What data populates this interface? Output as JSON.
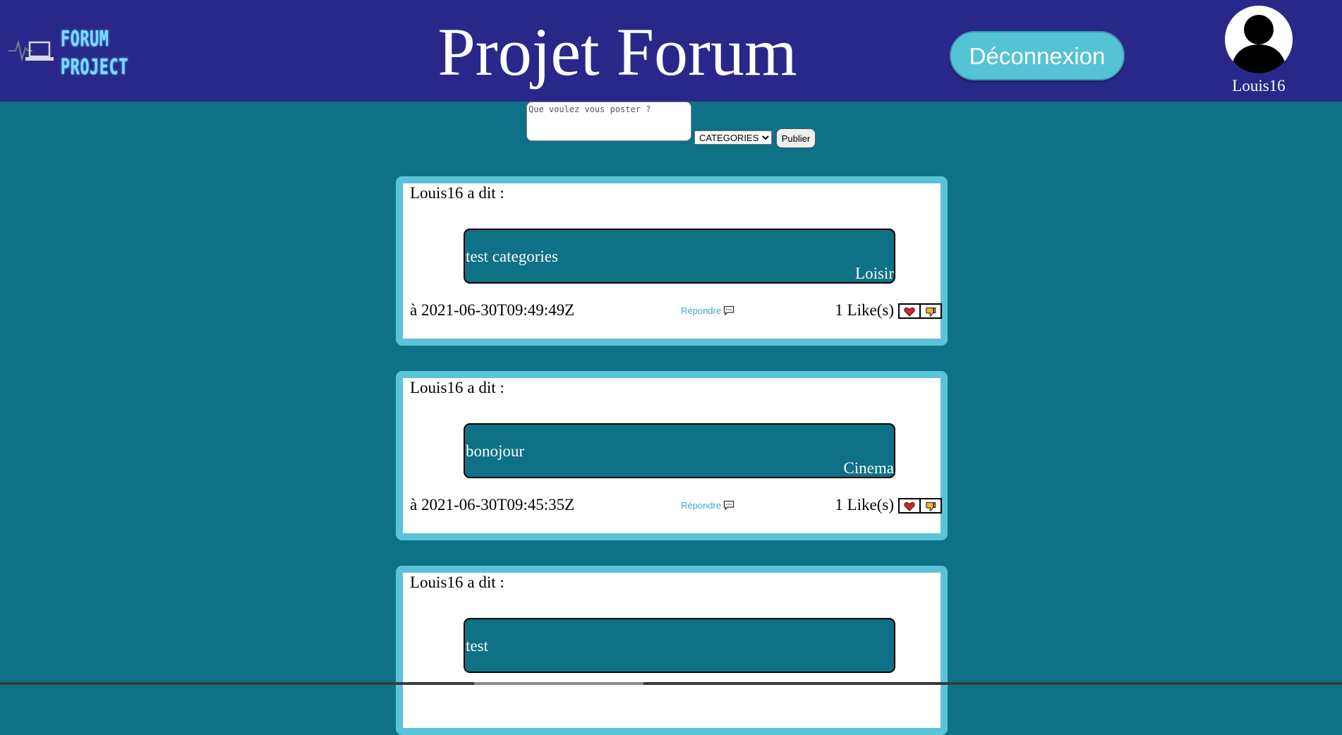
{
  "header": {
    "logo_text_line1": "FORUM",
    "logo_text_line2": "PROJECT",
    "title": "Projet Forum",
    "logout_label": "Déconnexion",
    "username": "Louis16"
  },
  "composer": {
    "placeholder": "Que voulez vous poster ?",
    "category_selected": "CATEGORIES",
    "publish_label": "Publier"
  },
  "posts": [
    {
      "author": "Louis16",
      "said": "a dit :",
      "content": "test categories",
      "category": "Loisir",
      "date": "à 2021-06-30T09:49:49Z",
      "reply_label": "Répondre",
      "likes": "1 Like(s)"
    },
    {
      "author": "Louis16",
      "said": "a dit :",
      "content": "bonojour",
      "category": "Cinema",
      "date": "à 2021-06-30T09:45:35Z",
      "reply_label": "Répondre",
      "likes": "1 Like(s)"
    },
    {
      "author": "Louis16",
      "said": "a dit :",
      "content": "test",
      "category": "",
      "date": "",
      "reply_label": "",
      "likes": ""
    }
  ],
  "colors": {
    "header_bg": "#29288a",
    "page_bg": "#0e7185",
    "card_border": "#5ac4d7",
    "logout_bg": "#55c3d6"
  }
}
